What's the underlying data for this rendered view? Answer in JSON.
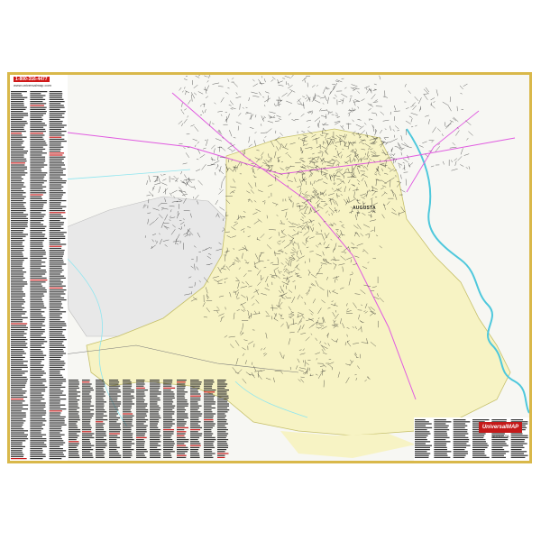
{
  "map": {
    "publisher": "UniversalMAP",
    "phone": "1-800-316-4477",
    "website": "www.universalmap.com",
    "city_label": "AUGUSTA",
    "edition_note": "AUGUSTA",
    "colors": {
      "frame": "#d9b84a",
      "county_fill": "#f7f3c4",
      "outside_fill": "#eeeeee",
      "water": "#8fe6f0",
      "highway": "#e05ae0",
      "streets": "#222222",
      "brand_red": "#c41a1a"
    }
  }
}
